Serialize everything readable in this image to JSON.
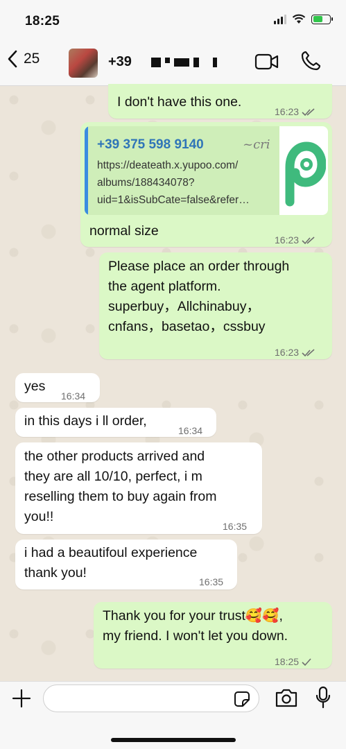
{
  "status_bar": {
    "time": "18:25"
  },
  "header": {
    "back_count": "25",
    "contact_prefix": "+39",
    "icons": [
      "chevron-left-icon",
      "video-camera-icon",
      "phone-icon"
    ]
  },
  "messages": [
    {
      "direction": "out",
      "text": "I don't have this one.",
      "time": "16:23",
      "status": "read"
    },
    {
      "direction": "out",
      "link_preview": {
        "phone": "+39 375 598 9140",
        "author": "~cri",
        "url": "https://deateath.x.yupoo.com/\nalbums/188434078?\nuid=1&isSubCate=false&refer…"
      },
      "text": "normal size",
      "time": "16:23",
      "status": "read"
    },
    {
      "direction": "out",
      "text": "Please place an order through\nthe agent platform.\nsuperbuy，Allchinabuy，\ncnfans，basetao，cssbuy",
      "time": "16:23",
      "status": "read"
    },
    {
      "direction": "in",
      "text": "yes",
      "time": "16:34"
    },
    {
      "direction": "in",
      "text": "in this days i ll order,",
      "time": "16:34"
    },
    {
      "direction": "in",
      "text": "the other products arrived and\nthey are all 10/10, perfect, i m\nreselling them to buy again from\nyou!!",
      "time": "16:35"
    },
    {
      "direction": "in",
      "text": "i had a beautifoul experience\nthank you!",
      "time": "16:35"
    },
    {
      "direction": "out",
      "text": "Thank you for your trust🥰🥰,\nmy friend. I won't let you down.",
      "time": "18:25",
      "status": "delivered"
    }
  ],
  "input_bar": {
    "placeholder": "",
    "icons": [
      "plus-icon",
      "sticker-icon",
      "camera-icon",
      "microphone-icon"
    ]
  },
  "colors": {
    "outgoing_bubble": "#dbf8c6",
    "incoming_bubble": "#ffffff",
    "read_check": "#6f6f6f",
    "link_phone": "#2f75b8"
  }
}
